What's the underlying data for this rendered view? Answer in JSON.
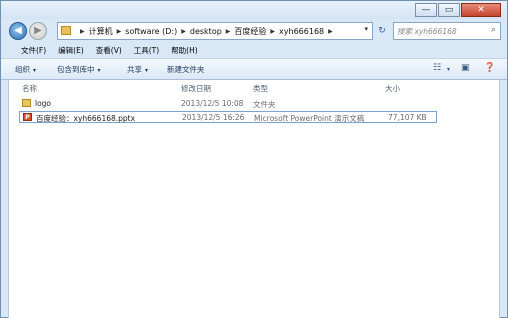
{
  "window": {
    "buttons": {
      "minimize": "—",
      "maximize": "▭",
      "close": "✕"
    }
  },
  "nav": {
    "back_glyph": "◀",
    "forward_glyph": "▶",
    "address": {
      "crumbs": [
        "计算机",
        "software (D:)",
        "desktop",
        "百度经验",
        "xyh666168"
      ],
      "separator": "▶",
      "dropdown": "▾"
    },
    "refresh_glyph": "↻",
    "search": {
      "placeholder": "搜索 xyh666168",
      "icon": "⌕"
    }
  },
  "menubar": [
    "文件(F)",
    "编辑(E)",
    "查看(V)",
    "工具(T)",
    "帮助(H)"
  ],
  "toolbar": {
    "organize": "组织",
    "include_in_library": "包含到库中",
    "share": "共享",
    "new_folder": "新建文件夹",
    "caret": "▾"
  },
  "columns": {
    "name": "名称",
    "modified": "修改日期",
    "type": "类型",
    "size": "大小"
  },
  "files": [
    {
      "icon": "folder-icon",
      "name": "logo",
      "modified": "2013/12/5 10:08",
      "type": "文件夹",
      "size": ""
    },
    {
      "icon": "pptx-file-icon",
      "name": "百度经验：xyh666168.pptx",
      "modified": "2013/12/5 16:26",
      "type": "Microsoft PowerPoint 演示文稿",
      "size": "77,107 KB"
    }
  ],
  "colors": {
    "chrome": "#d9e8f7",
    "toolbar_text": "#1e395b",
    "selection_border": "#7da2ce"
  }
}
